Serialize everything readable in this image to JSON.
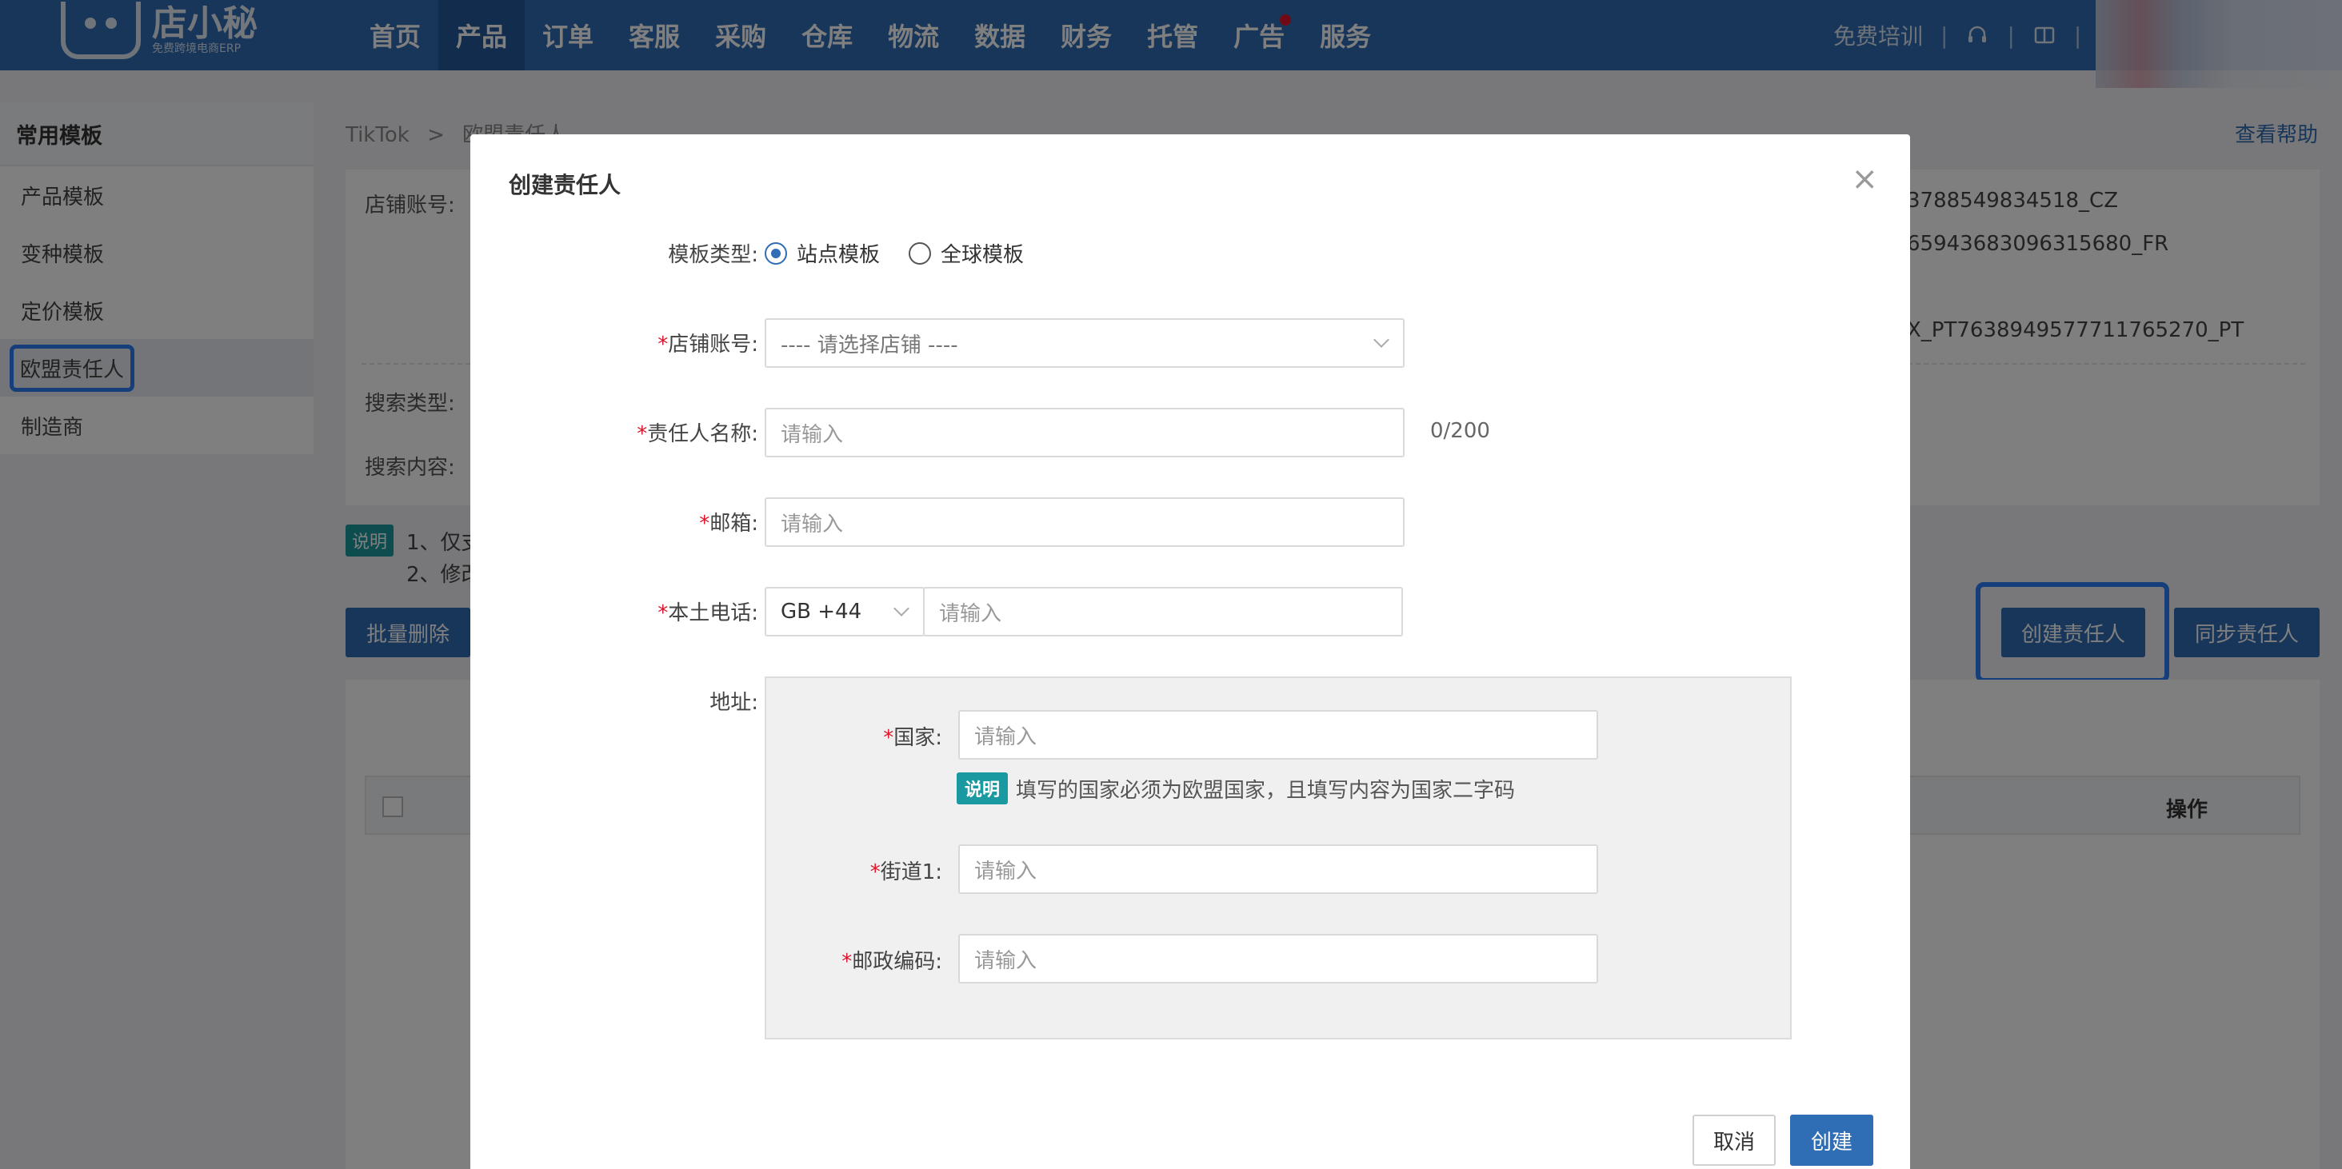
{
  "nav": {
    "logo_main": "店小秘",
    "logo_sub": "免费跨境电商ERP",
    "items": [
      "首页",
      "产品",
      "订单",
      "客服",
      "采购",
      "仓库",
      "物流",
      "数据",
      "财务",
      "托管",
      "广告",
      "服务"
    ],
    "active_index": 1,
    "ad_dot_color": "#e0142c",
    "training": "免费培训",
    "icons": [
      "headset-icon",
      "book-icon"
    ]
  },
  "sidebar": {
    "title": "常用模板",
    "items": [
      "产品模板",
      "变种模板",
      "定价模板",
      "欧盟责任人",
      "制造商"
    ],
    "active_index": 3
  },
  "page": {
    "crumb_root": "TikTok",
    "crumb_sep": ">",
    "crumb_current": "欧盟责任人",
    "help": "查看帮助",
    "store_label": "店铺账号:",
    "store_values": [
      "3788549834518_CZ",
      "65943683096315680_FR",
      "X_PT7638949577711765270_PT"
    ],
    "search_type_label": "搜索类型:",
    "search_content_label": "搜索内容:",
    "note_badge": "说明",
    "note_line1": "1、仅支",
    "note_line2": "2、修改",
    "batch_delete": "批量删除",
    "create_responsible": "创建责任人",
    "sync_responsible": "同步责任人",
    "col_action": "操作"
  },
  "modal": {
    "title": "创建责任人",
    "template_type_label": "模板类型:",
    "template_options": [
      "站点模板",
      "全球模板"
    ],
    "template_selected": 0,
    "store_label": "店铺账号:",
    "store_placeholder": "---- 请选择店铺 ----",
    "name_label": "责任人名称:",
    "name_placeholder": "请输入",
    "name_counter": "0/200",
    "email_label": "邮箱:",
    "email_placeholder": "请输入",
    "phone_label": "本土电话:",
    "phone_code": "GB +44",
    "phone_placeholder": "请输入",
    "address_label": "地址:",
    "country_label": "国家:",
    "country_placeholder": "请输入",
    "tip_badge": "说明",
    "tip_text": "填写的国家必须为欧盟国家，且填写内容为国家二字码",
    "street_label": "街道1:",
    "street_placeholder": "请输入",
    "postcode_label": "邮政编码:",
    "postcode_placeholder": "请输入",
    "cancel": "取消",
    "create": "创建"
  }
}
